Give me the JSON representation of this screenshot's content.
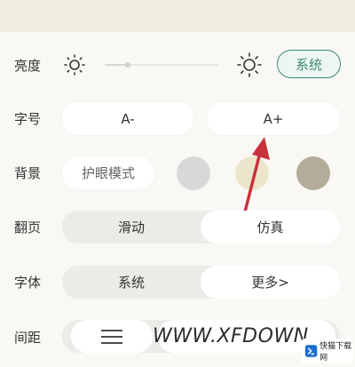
{
  "brightness": {
    "label": "亮度",
    "system_button": "系统",
    "accent": "#3f8a7a",
    "level": 0.2
  },
  "font_size": {
    "label": "字号",
    "decrease": "A-",
    "increase": "A+"
  },
  "background": {
    "label": "背景",
    "eye_mode": "护眼模式",
    "swatches": [
      "#d8d8d8",
      "#ebe5cc",
      "#b3ac98"
    ]
  },
  "page_turn": {
    "label": "翻页",
    "options": [
      "滑动",
      "仿真"
    ],
    "selected": "仿真"
  },
  "font": {
    "label": "字体",
    "system": "系统",
    "more": "更多>"
  },
  "spacing": {
    "label": "间距"
  },
  "watermark": {
    "text": "WWW.XFDOWN",
    "badge_text": "快猫下载网"
  },
  "arrow_color": "#c8323b"
}
